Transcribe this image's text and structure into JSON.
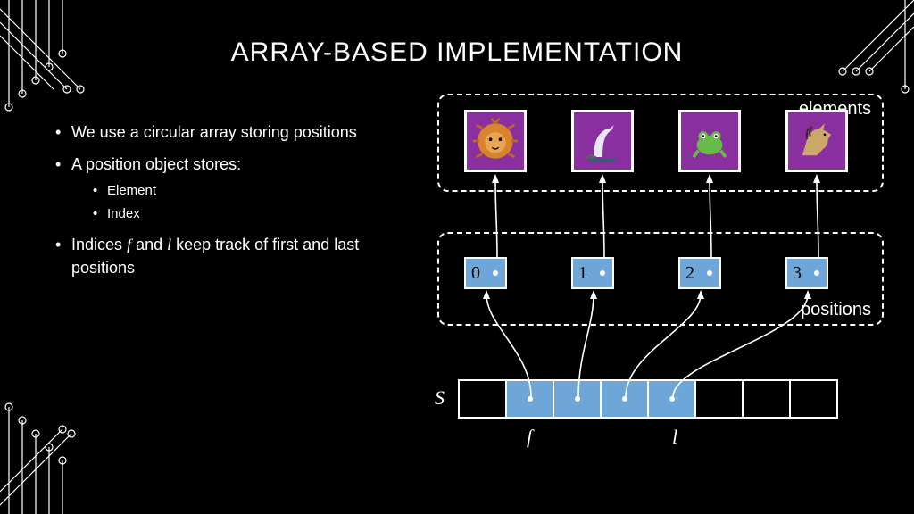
{
  "slide": {
    "title": "ARRAY-BASED IMPLEMENTATION",
    "bullets": {
      "b1": "We use a circular array storing positions",
      "b2": "A position object stores:",
      "b2a": "Element",
      "b2b": "Index",
      "b3_pre": "Indices ",
      "b3_f": "f",
      "b3_mid": " and ",
      "b3_l": "l",
      "b3_post": " keep track of first and last positions"
    }
  },
  "diagram": {
    "elements_label": "elements",
    "positions_label": "positions",
    "elements": [
      "lion",
      "heron",
      "frog",
      "horse"
    ],
    "position_indices": [
      "0",
      "1",
      "2",
      "3"
    ],
    "s_label": "S",
    "s_cells": [
      false,
      true,
      true,
      true,
      true,
      false,
      false,
      false
    ],
    "f_label": "f",
    "l_label": "l"
  }
}
